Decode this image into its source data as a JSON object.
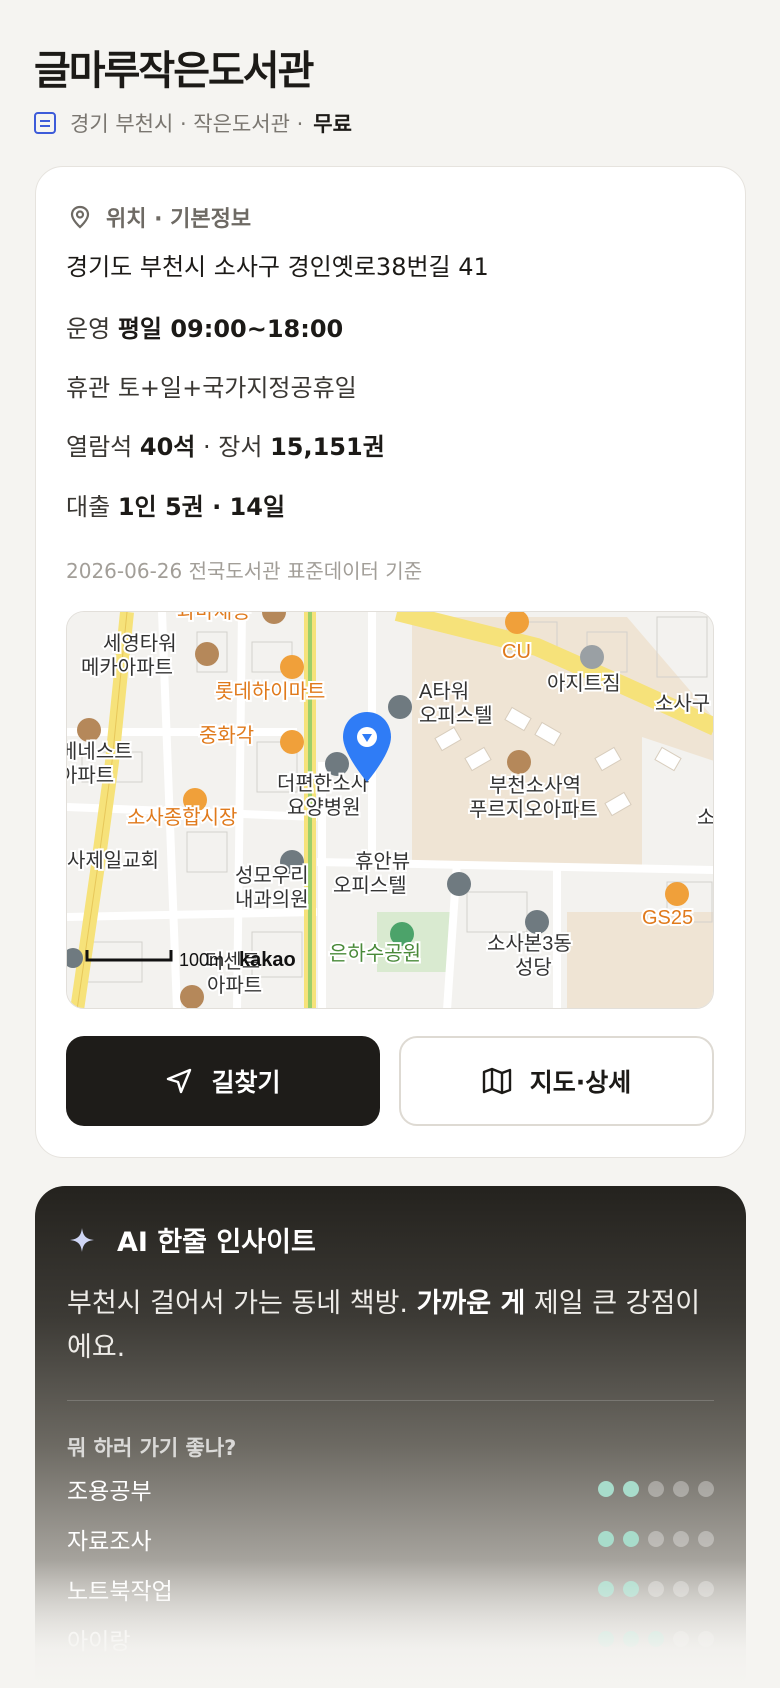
{
  "header": {
    "title": "글마루작은도서관",
    "region": "경기 부천시 · 작은도서관 ·",
    "fee": "무료"
  },
  "info": {
    "section_title": "위치 · 기본정보",
    "address": "경기도 부천시 소사구 경인옛로38번길 41",
    "hours_label": "운영",
    "hours_value": "평일 09:00~18:00",
    "closed_label": "휴관",
    "closed_value": "토+일+국가지정공휴일",
    "seats_label": "열람석",
    "seats_value": "40석",
    "books_sep": "· 장서",
    "books_value": "15,151권",
    "loan_label": "대출",
    "loan_value": "1인 5권 · 14일",
    "data_note": "2026-06-26 전국도서관 표준데이터 기준"
  },
  "map": {
    "labels": {
      "mart_top": "과마채송",
      "seyoung": "세영타워",
      "seyoung2": "메카아파트",
      "lotte": "롯데하이마트",
      "chinese": "중화각",
      "best": "베네스트",
      "best2": "아파트",
      "market": "소사종합시장",
      "church": "사제일교회",
      "atower": "A타워",
      "atower2": "오피스텔",
      "hospital": "더편한소사",
      "hospital2": "요양병원",
      "cu": "CU",
      "azit": "아지트짐",
      "sosa_top": "소사구",
      "prugio": "부천소사역",
      "prugio2": "푸르지오아파트",
      "sosa_edge": "소",
      "clinic": "성모우리",
      "clinic2": "내과의원",
      "huan": "휴안뷰",
      "huan2": "오피스텔",
      "park": "은하수공원",
      "dong": "소사본3동",
      "dong2": "성당",
      "gs": "GS25",
      "apt_bottom": "더센트",
      "apt_bottom2": "아파트",
      "scale": "100m",
      "brand": "kakao"
    }
  },
  "actions": {
    "directions": "길찾기",
    "map_detail": "지도·상세"
  },
  "ai": {
    "title": "AI 한줄 인사이트",
    "text_before": "부천시 걸어서 가는 동네 책방. ",
    "text_bold": "가까운 게",
    "text_after": " 제일 큰 강점이에요.",
    "question": "뭐 하러 가기 좋나?",
    "ratings": [
      {
        "label": "조용공부",
        "score": 2,
        "max": 5
      },
      {
        "label": "자료조사",
        "score": 2,
        "max": 5
      },
      {
        "label": "노트북작업",
        "score": 2,
        "max": 5
      },
      {
        "label": "아이랑",
        "score": 3,
        "max": 5
      }
    ]
  },
  "colors": {
    "accent_blue": "#3d5bd9",
    "pin_blue": "#2f7cf6",
    "rating_on": "#a8dccb",
    "poi_orange": "#e07a1c"
  }
}
